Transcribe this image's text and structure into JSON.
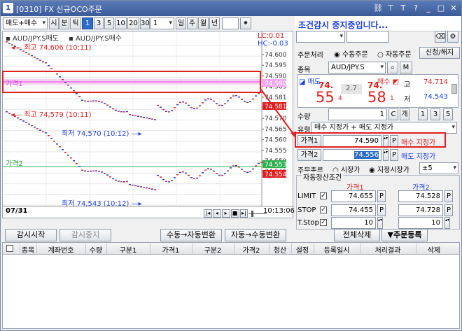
{
  "titlebar": {
    "text": "[0310]  FX 신규OCO주문",
    "icon": "1"
  },
  "toolbar": {
    "side_select": "매도+매수",
    "period_buttons": [
      "시",
      "분",
      "틱",
      "1",
      "3",
      "5",
      "10",
      "20",
      "30",
      "1"
    ],
    "period_selected": "1",
    "period2": [
      "일",
      "주",
      "월",
      "년"
    ]
  },
  "chart": {
    "legend_sell": "AUD/JPY.S매도",
    "legend_buy": "AUD/JPY.S매수",
    "lc": "LC:0.01",
    "hc": "HC:-0.03",
    "y_ticks": [
      "74.600",
      "74.595",
      "74.590",
      "74.585",
      "74.581",
      "74.575",
      "74.570",
      "74.565",
      "74.560",
      "74.555",
      "74.550",
      "74.545"
    ],
    "price1_tag": "74.590",
    "price1_bg_tag": "74.581",
    "price2_tag": "74.553",
    "price2_red_tag": "74.554",
    "label_price1": "가격1",
    "label_price2": "가격2",
    "ann_high1": "최고 74,606 (10:11)",
    "ann_high2": "최고 74,579 (10:11)",
    "ann_low1": "최저 74,570 (10:12)",
    "ann_low2": "최저 74,543 (10:12)",
    "date": "07/31",
    "time": "10:13:06"
  },
  "right": {
    "header": "조건감시 중지중입니다...",
    "order_label": "주문처리",
    "manual": "수동주문",
    "auto": "자동주문",
    "apply_btn": "신청/해지",
    "symbol_label": "종목",
    "symbol": "AUD/JPY.S",
    "sell_label": "매도",
    "buy_label": "매수",
    "sell_big": "74.",
    "sell_num": "55",
    "sell_sub": "4",
    "spread": "2.7",
    "buy_big": "74.",
    "buy_num": "58",
    "buy_sub": "1",
    "high_label": "고",
    "high": "74.714",
    "low_label": "저",
    "low": "74.543",
    "qty_label": "수량",
    "qty": "1",
    "qty_btns": [
      "C",
      "개",
      "1",
      "3",
      "5"
    ],
    "type_label": "유형",
    "type_value": "매수 지정가 + 매도 지정가",
    "price1_label": "가격1",
    "price1": "74.590",
    "price1_type": "매수 지정가",
    "price2_label": "가격2",
    "price2": "74.556",
    "price2_type": "매도 지정가",
    "ordkind_label": "주문종류",
    "market": "시장가",
    "limit_market": "지정시장가",
    "tolerance": "±5",
    "auto_label": "자동청산조건",
    "col_price1": "가격1",
    "col_price2": "가격2",
    "limit_label": "LIMIT",
    "stop_label": "STOP",
    "tstop_label": "T.Stop",
    "limit1": "74.655",
    "limit2": "74.528",
    "stop1": "74.455",
    "stop2": "74.728",
    "tstop1": "10",
    "tstop2": "10"
  },
  "buttons": {
    "start": "감시시작",
    "stop": "감시중지",
    "manual_to_auto": "수동→자동변환",
    "auto_to_manual": "자동→수동변환",
    "delete_all": "전체삭제",
    "register": "▼주문등록"
  },
  "grid": {
    "columns": [
      "종목",
      "계좌번호",
      "수량",
      "구분1",
      "가격1",
      "구분2",
      "가격2",
      "청산",
      "설정",
      "등록일시",
      "처리결과",
      "삭제"
    ]
  },
  "colors": {
    "red": "#e02020",
    "blue": "#1a3ee0",
    "title": "#3a5a98",
    "highlight": "#e02020"
  }
}
